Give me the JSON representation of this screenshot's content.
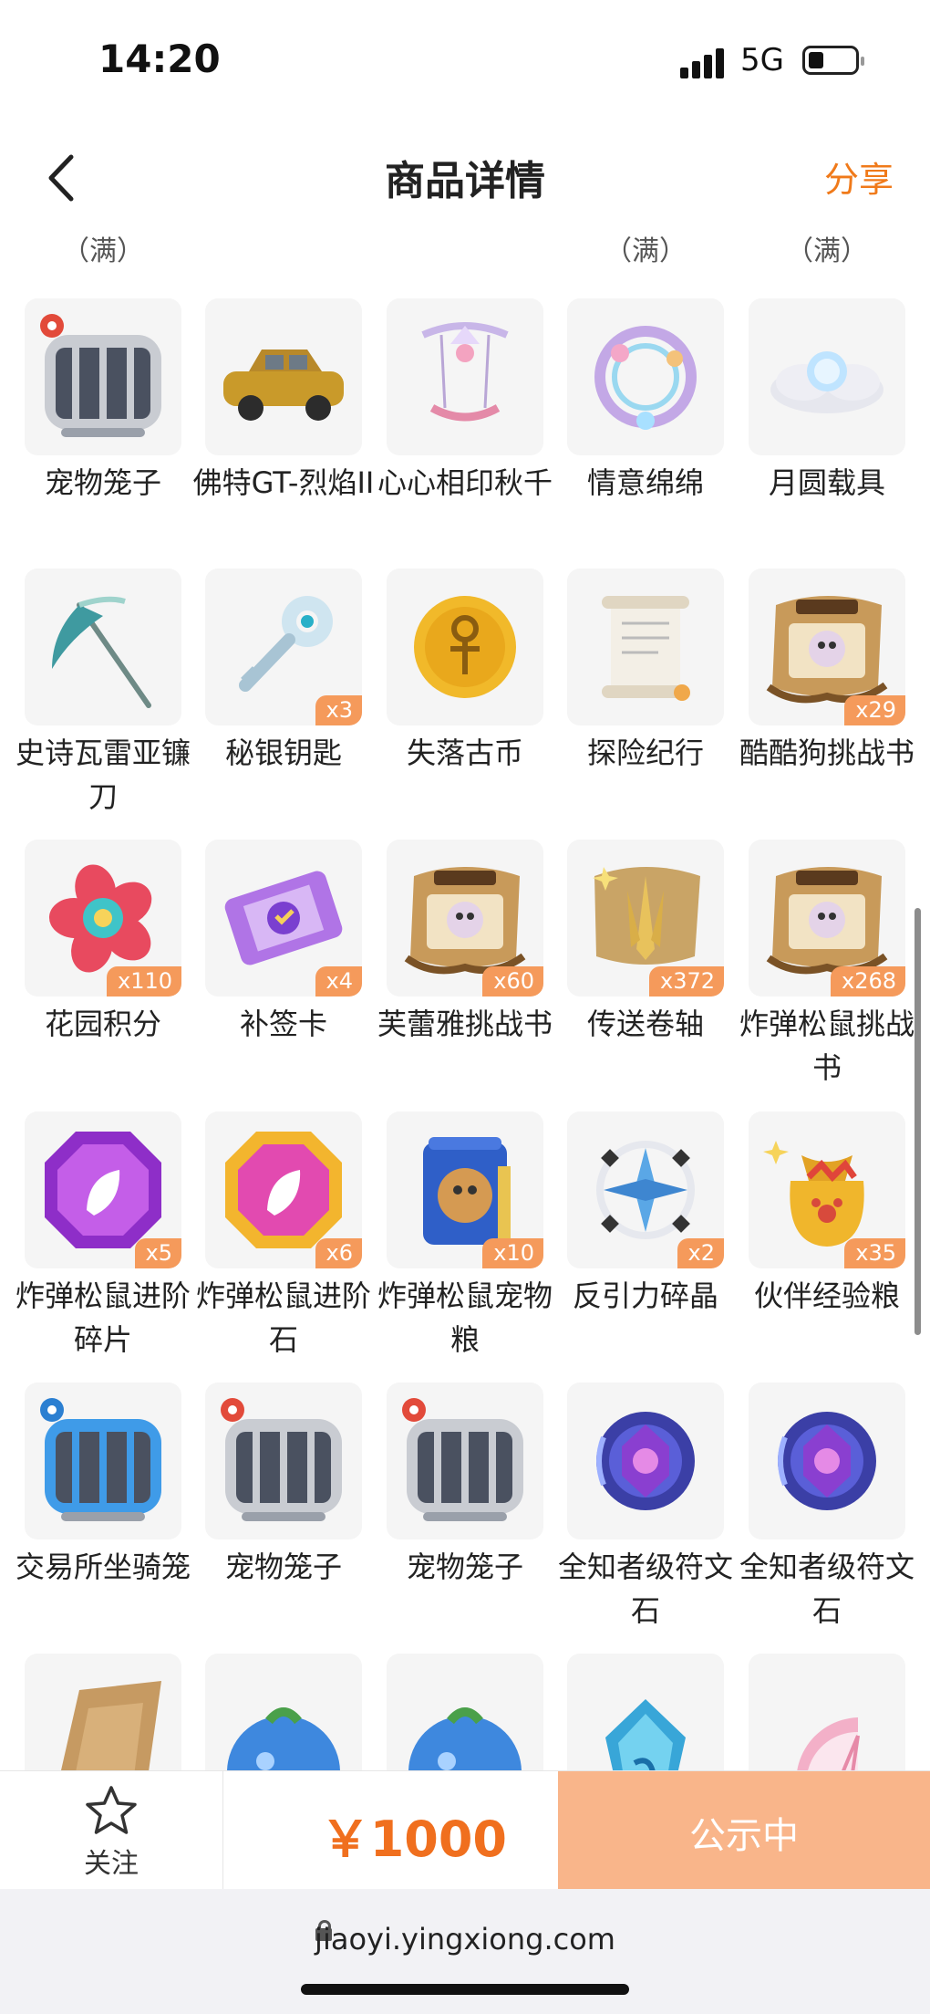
{
  "status_bar": {
    "time": "14:20",
    "network": "5G"
  },
  "header": {
    "title": "商品详情",
    "share_label": "分享",
    "back_icon": "chevron-left-icon"
  },
  "full_tags": [
    "（满）",
    "",
    "",
    "（满）",
    "（满）"
  ],
  "items": [
    {
      "name": "宠物笼子",
      "count": "",
      "icon": "pet-cage-icon"
    },
    {
      "name": "佛特GT-烈焰II",
      "count": "",
      "icon": "car-icon"
    },
    {
      "name": "心心相印秋千",
      "count": "",
      "icon": "swing-icon"
    },
    {
      "name": "情意绵绵",
      "count": "",
      "icon": "wreath-icon"
    },
    {
      "name": "月圆载具",
      "count": "",
      "icon": "moon-cloud-icon"
    },
    {
      "name": "史诗瓦雷亚镰刀",
      "count": "",
      "icon": "scythe-icon"
    },
    {
      "name": "秘银钥匙",
      "count": "x3",
      "icon": "key-icon"
    },
    {
      "name": "失落古币",
      "count": "",
      "icon": "coin-icon"
    },
    {
      "name": "探险纪行",
      "count": "",
      "icon": "scroll-icon"
    },
    {
      "name": "酷酷狗挑战书",
      "count": "x29",
      "icon": "wanted-poster-icon"
    },
    {
      "name": "花园积分",
      "count": "x110",
      "icon": "flower-badge-icon"
    },
    {
      "name": "补签卡",
      "count": "x4",
      "icon": "ticket-icon"
    },
    {
      "name": "芙蕾雅挑战书",
      "count": "x60",
      "icon": "wanted-poster-icon"
    },
    {
      "name": "传送卷轴",
      "count": "x372",
      "icon": "teleport-scroll-icon"
    },
    {
      "name": "炸弹松鼠挑战书",
      "count": "x268",
      "icon": "wanted-poster-icon"
    },
    {
      "name": "炸弹松鼠进阶碎片",
      "count": "x5",
      "icon": "purple-gem-icon"
    },
    {
      "name": "炸弹松鼠进阶石",
      "count": "x6",
      "icon": "pink-gem-icon"
    },
    {
      "name": "炸弹松鼠宠物粮",
      "count": "x10",
      "icon": "pet-food-bag-icon"
    },
    {
      "name": "反引力碎晶",
      "count": "x2",
      "icon": "crystal-shard-icon"
    },
    {
      "name": "伙伴经验粮",
      "count": "x35",
      "icon": "gold-sack-icon"
    },
    {
      "name": "交易所坐骑笼",
      "count": "",
      "icon": "mount-cage-icon"
    },
    {
      "name": "宠物笼子",
      "count": "",
      "icon": "pet-cage-icon"
    },
    {
      "name": "宠物笼子",
      "count": "",
      "icon": "pet-cage-icon"
    },
    {
      "name": "全知者级符文石",
      "count": "",
      "icon": "rune-stone-icon"
    },
    {
      "name": "全知者级符文石",
      "count": "",
      "icon": "rune-stone-icon"
    },
    {
      "name": "",
      "count": "",
      "icon": "parchment-icon"
    },
    {
      "name": "",
      "count": "",
      "icon": "blue-berry-icon"
    },
    {
      "name": "",
      "count": "",
      "icon": "blue-berry-icon"
    },
    {
      "name": "",
      "count": "",
      "icon": "blue-gem-icon"
    },
    {
      "name": "",
      "count": "",
      "icon": "citrus-slice-icon"
    }
  ],
  "action_bar": {
    "follow_label": "关注",
    "price": "￥1000",
    "status_label": "公示中"
  },
  "browser": {
    "url": "jiaoyi.yingxiong.com"
  },
  "colors": {
    "accent": "#f07a1a",
    "price": "#f06f1e",
    "button": "#f9b58a",
    "badge": "#f59a5b"
  }
}
